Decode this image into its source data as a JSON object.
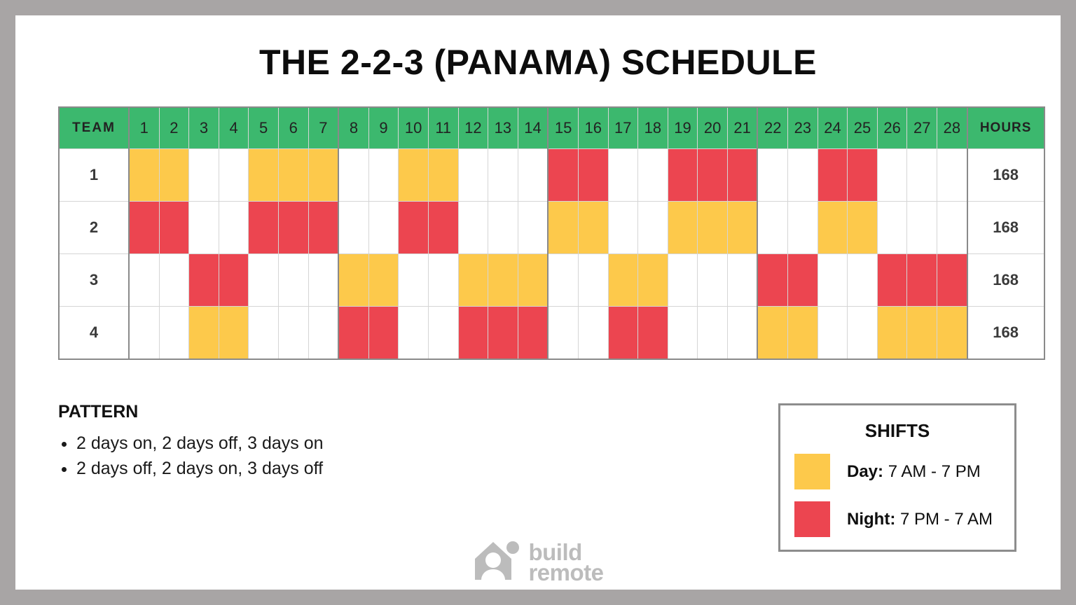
{
  "title": "THE 2-2-3 (PANAMA) SCHEDULE",
  "table": {
    "team_header": "TEAM",
    "hours_header": "HOURS",
    "days": [
      1,
      2,
      3,
      4,
      5,
      6,
      7,
      8,
      9,
      10,
      11,
      12,
      13,
      14,
      15,
      16,
      17,
      18,
      19,
      20,
      21,
      22,
      23,
      24,
      25,
      26,
      27,
      28
    ],
    "week_break_after": [
      7,
      14,
      21
    ],
    "rows": [
      {
        "team": "1",
        "hours": "168",
        "shifts": [
          "D",
          "D",
          "O",
          "O",
          "D",
          "D",
          "D",
          "O",
          "O",
          "D",
          "D",
          "O",
          "O",
          "O",
          "N",
          "N",
          "O",
          "O",
          "N",
          "N",
          "N",
          "O",
          "O",
          "N",
          "N",
          "O",
          "O",
          "O"
        ]
      },
      {
        "team": "2",
        "hours": "168",
        "shifts": [
          "N",
          "N",
          "O",
          "O",
          "N",
          "N",
          "N",
          "O",
          "O",
          "N",
          "N",
          "O",
          "O",
          "O",
          "D",
          "D",
          "O",
          "O",
          "D",
          "D",
          "D",
          "O",
          "O",
          "D",
          "D",
          "O",
          "O",
          "O"
        ]
      },
      {
        "team": "3",
        "hours": "168",
        "shifts": [
          "O",
          "O",
          "N",
          "N",
          "O",
          "O",
          "O",
          "D",
          "D",
          "O",
          "O",
          "D",
          "D",
          "D",
          "O",
          "O",
          "D",
          "D",
          "O",
          "O",
          "O",
          "N",
          "N",
          "O",
          "O",
          "N",
          "N",
          "N"
        ]
      },
      {
        "team": "4",
        "hours": "168",
        "shifts": [
          "O",
          "O",
          "D",
          "D",
          "O",
          "O",
          "O",
          "N",
          "N",
          "O",
          "O",
          "N",
          "N",
          "N",
          "O",
          "O",
          "N",
          "N",
          "O",
          "O",
          "O",
          "D",
          "D",
          "O",
          "O",
          "D",
          "D",
          "D"
        ]
      }
    ]
  },
  "pattern": {
    "heading": "PATTERN",
    "items": [
      "2 days on, 2 days off, 3 days on",
      "2 days off, 2 days on, 3 days off"
    ]
  },
  "legend": {
    "heading": "SHIFTS",
    "rows": [
      {
        "swatch": "day-swatch",
        "label": "Day:",
        "value": "7 AM - 7 PM",
        "color": "#fdc94b"
      },
      {
        "swatch": "night-swatch",
        "label": "Night:",
        "value": "7 PM - 7 AM",
        "color": "#ec4550"
      }
    ]
  },
  "footer": {
    "logo_line1": "build",
    "logo_line2": "remote"
  },
  "colors": {
    "day": "#fdc94b",
    "night": "#ec4550",
    "off": "#ffffff",
    "header_green": "#3cb86e",
    "frame_gray": "#a8a5a5"
  }
}
